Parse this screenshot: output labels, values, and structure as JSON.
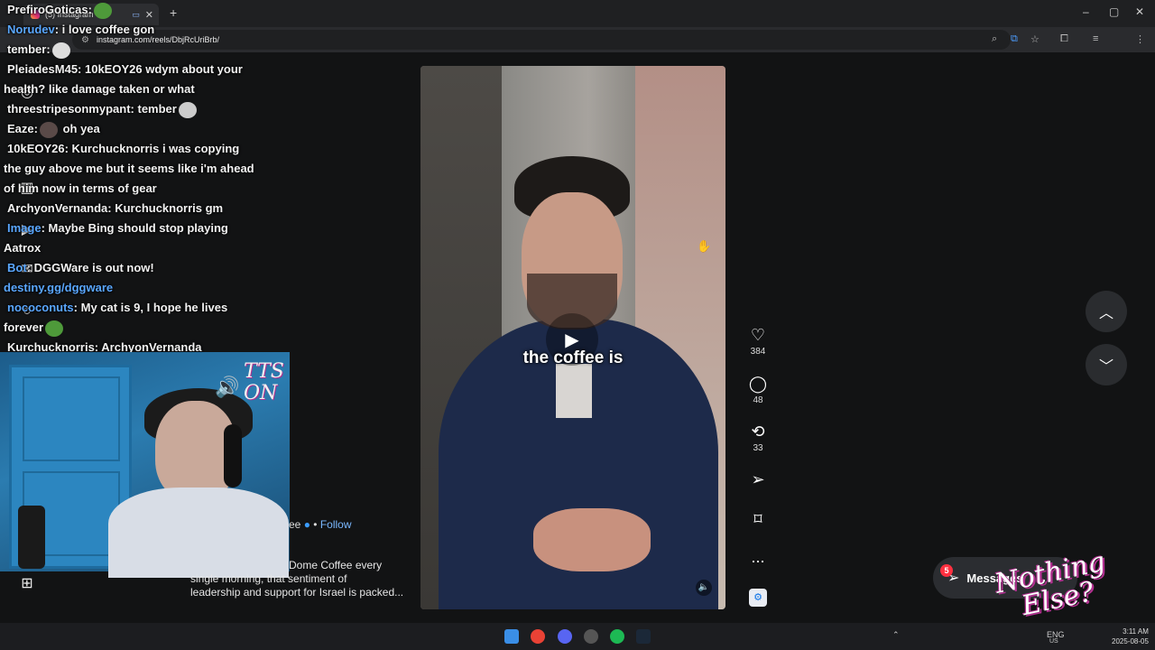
{
  "browser": {
    "tab_title": "(5) Instagram",
    "url": "instagram.com/reels/DbjRcUriBrb/",
    "new_tab": "+",
    "window_controls": [
      "–",
      "▢",
      "✕"
    ]
  },
  "chat": {
    "lines": [
      {
        "user": "PrefiroGoticas:",
        "text": ""
      },
      {
        "user": "Norudev",
        "text": ": i love coffee gon"
      },
      {
        "user": "tember:",
        "text": ""
      },
      {
        "user": "PleiadesM45:",
        "text": " 10kEOY26 wdym about your"
      },
      {
        "user": "",
        "text": "health? like damage taken or what"
      },
      {
        "user": "threestripesonmypant:",
        "text": " tember"
      },
      {
        "user": "Eaze:",
        "text": " oh yea"
      },
      {
        "user": "10kEOY26:",
        "text": " Kurchucknorris  i was copying"
      },
      {
        "user": "",
        "text": "the guy above me but it seems like i'm ahead"
      },
      {
        "user": "",
        "text": "of him now in terms of gear"
      },
      {
        "user": "ArchyonVernanda:",
        "text": " Kurchucknorris  gm"
      },
      {
        "user": "Image",
        "text": ":  Maybe Bing should stop playing"
      },
      {
        "user": "",
        "text": "Aatrox"
      },
      {
        "user": "Bot",
        "text": ":  DGGWare is out now!"
      },
      {
        "user": "",
        "text": "destiny.gg/dggware"
      },
      {
        "user": "nococonuts",
        "text": ": My cat is 9, I hope he lives"
      },
      {
        "user": "",
        "text": "forever"
      },
      {
        "user": "Kurchucknorris:",
        "text": " ArchyonVernanda"
      }
    ]
  },
  "overlay": {
    "tts_text": "TTS ON"
  },
  "reel": {
    "caption_overlay": "the coffee is",
    "likes": "384",
    "comments": "48",
    "reposts": "33",
    "more": "...",
    "follow_prefix": "ee",
    "follow_label": "Follow",
    "caption_lines": [
      "Dome Coffee every",
      "single morning, that sentiment of",
      "leadership and support for Israel is packed..."
    ]
  },
  "messages": {
    "label": "Messages",
    "badge": "5"
  },
  "watermark": {
    "text_line1": "Nothing",
    "text_line2": "Else?"
  },
  "taskbar": {
    "language": "ENG",
    "region": "US",
    "time": "3:11 AM",
    "date": "2025-08-05"
  },
  "colors": {
    "page_bg": "#121314",
    "accent_blue": "#5aa7ff",
    "notification_red": "#ff3040"
  }
}
